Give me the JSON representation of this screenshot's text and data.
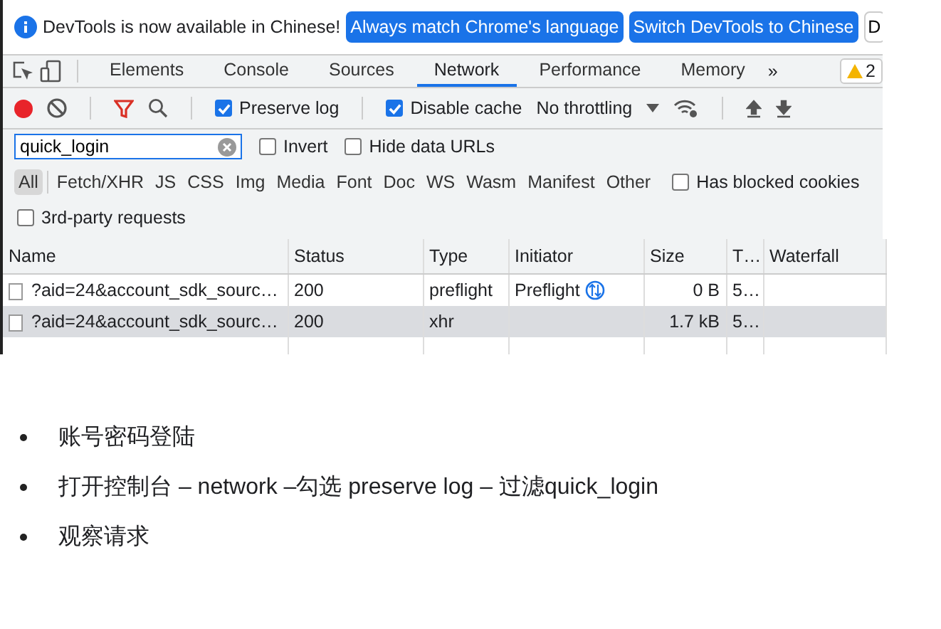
{
  "infobar": {
    "message": "DevTools is now available in Chinese!",
    "buttons": [
      "Always match Chrome's language",
      "Switch DevTools to Chinese"
    ],
    "cut_button": "D"
  },
  "tabs": [
    {
      "label": "Elements",
      "selected": false
    },
    {
      "label": "Console",
      "selected": false
    },
    {
      "label": "Sources",
      "selected": false
    },
    {
      "label": "Network",
      "selected": true
    },
    {
      "label": "Performance",
      "selected": false
    },
    {
      "label": "Memory",
      "selected": false
    }
  ],
  "tabs_more": "»",
  "warnings": "2",
  "toolbar": {
    "recording": true,
    "preserve_log": {
      "label": "Preserve log",
      "checked": true
    },
    "disable_cache": {
      "label": "Disable cache",
      "checked": true
    },
    "throttling": "No throttling"
  },
  "filter": {
    "value": "quick_login",
    "invert": {
      "label": "Invert",
      "checked": false
    },
    "hide_data_urls": {
      "label": "Hide data URLs",
      "checked": false
    }
  },
  "types": [
    {
      "label": "All",
      "selected": true
    },
    {
      "label": "Fetch/XHR",
      "selected": false
    },
    {
      "label": "JS",
      "selected": false
    },
    {
      "label": "CSS",
      "selected": false
    },
    {
      "label": "Img",
      "selected": false
    },
    {
      "label": "Media",
      "selected": false
    },
    {
      "label": "Font",
      "selected": false
    },
    {
      "label": "Doc",
      "selected": false
    },
    {
      "label": "WS",
      "selected": false
    },
    {
      "label": "Wasm",
      "selected": false
    },
    {
      "label": "Manifest",
      "selected": false
    },
    {
      "label": "Other",
      "selected": false
    }
  ],
  "has_blocked_cookies": {
    "label": "Has blocked cookies",
    "checked": false
  },
  "third_party": {
    "label": "3rd-party requests",
    "checked": false
  },
  "table": {
    "columns": [
      "Name",
      "Status",
      "Type",
      "Initiator",
      "Size",
      "T…",
      "Waterfall"
    ],
    "rows": [
      {
        "selected": false,
        "cells": [
          "?aid=24&account_sdk_sourc…",
          "200",
          "preflight",
          "Preflight",
          "0 B",
          "5…",
          ""
        ]
      },
      {
        "selected": true,
        "cells": [
          "?aid=24&account_sdk_sourc…",
          "200",
          "xhr",
          "",
          "1.7 kB",
          "5…",
          ""
        ]
      }
    ]
  },
  "notes": [
    "账号密码登陆",
    "打开控制台 – network –勾选 preserve log – 过滤quick_login",
    "观察请求"
  ]
}
